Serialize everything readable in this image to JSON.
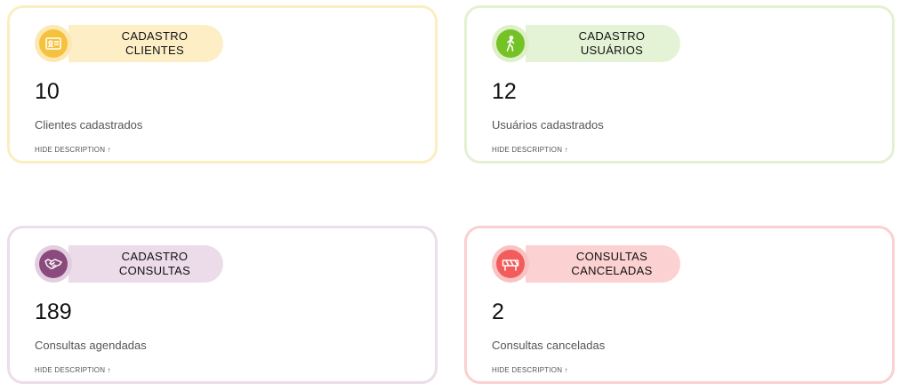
{
  "cards": [
    {
      "title": "CADASTRO\nCLIENTES",
      "value": "10",
      "description": "Clientes cadastrados",
      "toggle_label": "HIDE DESCRIPTION ↑",
      "icon": "contact-card-icon",
      "accent_color": "#f6c23e"
    },
    {
      "title": "CADASTRO\nUSUÁRIOS",
      "value": "12",
      "description": "Usuários cadastrados",
      "toggle_label": "HIDE DESCRIPTION ↑",
      "icon": "walking-person-icon",
      "accent_color": "#74c225"
    },
    {
      "title": "CADASTRO\nCONSULTAS",
      "value": "189",
      "description": "Consultas agendadas",
      "toggle_label": "HIDE DESCRIPTION ↑",
      "icon": "handshake-icon",
      "accent_color": "#8a4a7d"
    },
    {
      "title": "CONSULTAS\nCANCELADAS",
      "value": "2",
      "description": "Consultas canceladas",
      "toggle_label": "HIDE DESCRIPTION ↑",
      "icon": "barrier-icon",
      "accent_color": "#f45c5c"
    }
  ]
}
